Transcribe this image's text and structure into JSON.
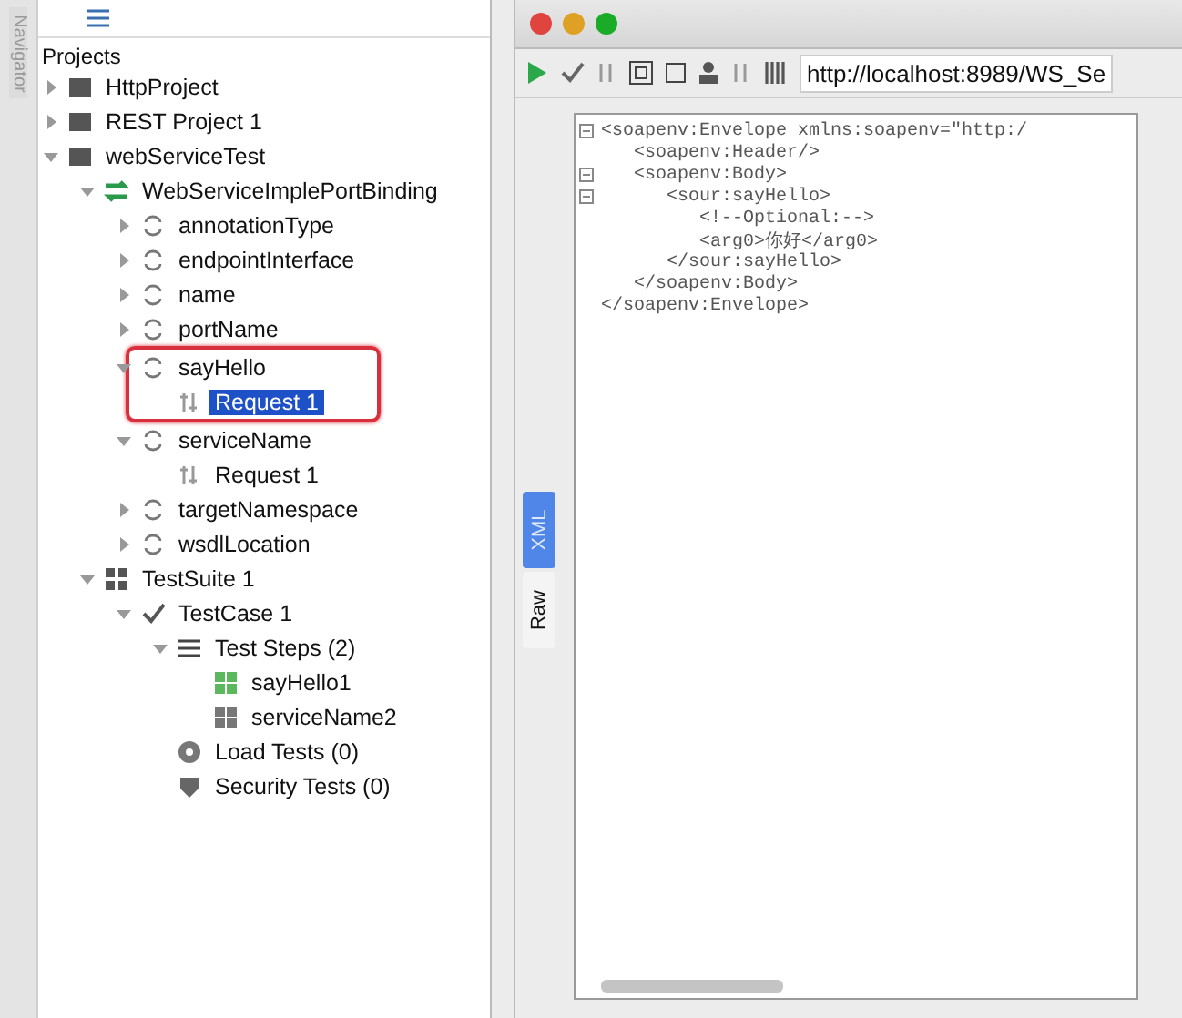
{
  "navigator_tab": "Navigator",
  "projects_title": "Projects",
  "tree": [
    {
      "label": "HttpProject",
      "kind": "folder",
      "expanded": false,
      "selected": false,
      "boxed": false
    },
    {
      "label": "REST Project 1",
      "kind": "folder",
      "expanded": false,
      "selected": false,
      "boxed": false
    },
    {
      "label": "webServiceTest",
      "kind": "folder",
      "expanded": true,
      "selected": false,
      "boxed": false,
      "children": [
        {
          "label": "WebServiceImplePortBinding",
          "kind": "interface",
          "expanded": true,
          "selected": false,
          "boxed": false,
          "children": [
            {
              "label": "annotationType",
              "kind": "operation",
              "expanded": false,
              "selected": false,
              "boxed": false
            },
            {
              "label": "endpointInterface",
              "kind": "operation",
              "expanded": false,
              "selected": false,
              "boxed": false
            },
            {
              "label": "name",
              "kind": "operation",
              "expanded": false,
              "selected": false,
              "boxed": false
            },
            {
              "label": "portName",
              "kind": "operation",
              "expanded": false,
              "selected": false,
              "boxed": false
            },
            {
              "label": "sayHello",
              "kind": "operation",
              "expanded": true,
              "selected": false,
              "boxed": true,
              "children": [
                {
                  "label": "Request 1",
                  "kind": "request",
                  "selected": true,
                  "boxed": false
                }
              ]
            },
            {
              "label": "serviceName",
              "kind": "operation",
              "expanded": true,
              "selected": false,
              "boxed": false,
              "children": [
                {
                  "label": "Request 1",
                  "kind": "request",
                  "selected": false,
                  "boxed": false
                }
              ]
            },
            {
              "label": "targetNamespace",
              "kind": "operation",
              "expanded": false,
              "selected": false,
              "boxed": false
            },
            {
              "label": "wsdlLocation",
              "kind": "operation",
              "expanded": false,
              "selected": false,
              "boxed": false
            }
          ]
        },
        {
          "label": "TestSuite 1",
          "kind": "suite",
          "expanded": true,
          "selected": false,
          "boxed": false,
          "children": [
            {
              "label": "TestCase 1",
              "kind": "case",
              "expanded": true,
              "selected": false,
              "boxed": false,
              "children": [
                {
                  "label": "Test Steps (2)",
                  "kind": "steps",
                  "expanded": true,
                  "selected": false,
                  "boxed": false,
                  "children": [
                    {
                      "label": "sayHello1",
                      "kind": "step-active",
                      "selected": false,
                      "boxed": false
                    },
                    {
                      "label": "serviceName2",
                      "kind": "step",
                      "selected": false,
                      "boxed": false
                    }
                  ]
                },
                {
                  "label": "Load Tests (0)",
                  "kind": "load",
                  "selected": false,
                  "boxed": false
                },
                {
                  "label": "Security Tests (0)",
                  "kind": "security",
                  "selected": false,
                  "boxed": false
                }
              ]
            }
          ]
        }
      ]
    }
  ],
  "endpoint": "http://localhost:8989/WS_Se",
  "xml_lines": [
    {
      "text": "<soapenv:Envelope xmlns:soapenv=\"http:/",
      "fold": true
    },
    {
      "text": "   <soapenv:Header/>",
      "fold": false
    },
    {
      "text": "   <soapenv:Body>",
      "fold": true
    },
    {
      "text": "      <sour:sayHello>",
      "fold": true
    },
    {
      "text": "         <!--Optional:-->",
      "fold": false
    },
    {
      "text": "         <arg0>你好</arg0>",
      "fold": false
    },
    {
      "text": "      </sour:sayHello>",
      "fold": false
    },
    {
      "text": "   </soapenv:Body>",
      "fold": false
    },
    {
      "text": "</soapenv:Envelope>",
      "fold": false
    }
  ],
  "side_tabs": [
    {
      "label": "XML",
      "selected": true
    },
    {
      "label": "Raw",
      "selected": false
    }
  ]
}
